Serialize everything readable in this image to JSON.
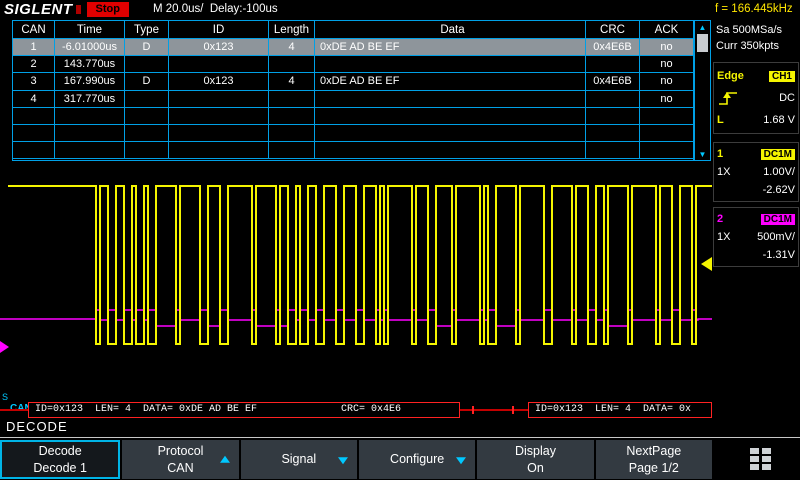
{
  "topbar": {
    "logo": "SIGLENT",
    "run_state": "Stop",
    "timebase": "M 20.0us/  Delay:-100us",
    "frequency": "f = 166.445kHz"
  },
  "sidebar": {
    "sample_rate": "Sa 500MSa/s",
    "memory": "Curr 350kpts",
    "trigger": {
      "type": "Edge",
      "source": "CH1",
      "coupling": "DC",
      "level_label": "L",
      "level": "1.68 V"
    },
    "ch1": {
      "number": "1",
      "coupling": "DC1M",
      "atten": "1X",
      "scale": "1.00V/",
      "offset": "-2.62V"
    },
    "ch2": {
      "number": "2",
      "coupling": "DC1M",
      "atten": "1X",
      "scale": "500mV/",
      "offset": "-1.31V"
    }
  },
  "decode_table": {
    "headers": [
      "CAN",
      "Time",
      "Type",
      "ID",
      "Length",
      "Data",
      "CRC",
      "ACK"
    ],
    "rows": [
      {
        "cells": [
          "1",
          "-6.01000us",
          "D",
          "0x123",
          "4",
          "0xDE AD BE EF",
          "0x4E6B",
          "no"
        ],
        "selected": true
      },
      {
        "cells": [
          "2",
          "143.770us",
          "",
          "",
          "",
          "",
          "",
          "no"
        ],
        "selected": false
      },
      {
        "cells": [
          "3",
          "167.990us",
          "D",
          "0x123",
          "4",
          "0xDE AD BE EF",
          "0x4E6B",
          "no"
        ],
        "selected": false
      },
      {
        "cells": [
          "4",
          "317.770us",
          "",
          "",
          "",
          "",
          "",
          "no"
        ],
        "selected": false
      },
      {
        "cells": [
          "",
          "",
          "",
          "",
          "",
          "",
          "",
          ""
        ],
        "selected": false
      },
      {
        "cells": [
          "",
          "",
          "",
          "",
          "",
          "",
          "",
          ""
        ],
        "selected": false
      },
      {
        "cells": [
          "",
          "",
          "",
          "",
          "",
          "",
          "",
          ""
        ],
        "selected": false
      }
    ]
  },
  "decode_bus": {
    "serial_label": "S",
    "protocol_label": "CAN",
    "frames": [
      "ID=0x123  LEN= 4  DATA= 0xDE AD BE EF              CRC= 0x4E6",
      "ID=0x123  LEN= 4  DATA= 0x"
    ]
  },
  "section_title": "DECODE",
  "menu": {
    "buttons": [
      {
        "line1": "Decode",
        "line2": "Decode 1",
        "arrow": "",
        "selected": true
      },
      {
        "line1": "Protocol",
        "line2": "CAN",
        "arrow": "up",
        "selected": false
      },
      {
        "line1": "Signal",
        "line2": "",
        "arrow": "down",
        "selected": false
      },
      {
        "line1": "Configure",
        "line2": "",
        "arrow": "down",
        "selected": false
      },
      {
        "line1": "Display",
        "line2": "On",
        "arrow": "",
        "selected": false
      },
      {
        "line1": "NextPage",
        "line2": "Page 1/2",
        "arrow": "",
        "selected": false
      }
    ]
  },
  "colors": {
    "accent": "#00a0e6",
    "ch1": "#f5f500",
    "ch2": "#ff00ff",
    "alert": "#d40000"
  }
}
